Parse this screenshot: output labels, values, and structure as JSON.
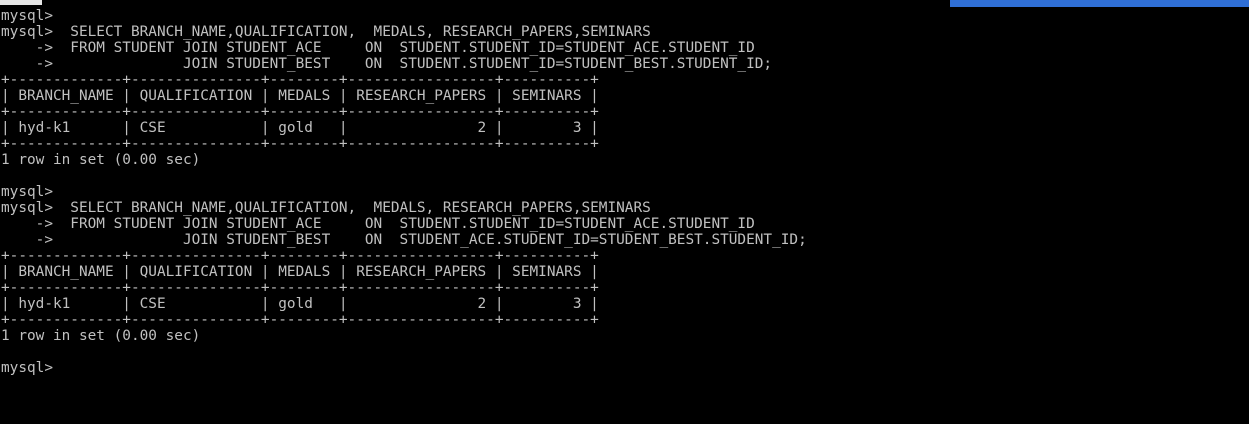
{
  "colors": {
    "background": "#000000",
    "text": "#c0c0c0",
    "titlebar_accent": "#2f6fd6"
  },
  "console": {
    "lines": [
      "mysql>",
      "mysql>  SELECT BRANCH_NAME,QUALIFICATION,  MEDALS, RESEARCH_PAPERS,SEMINARS",
      "    ->  FROM STUDENT JOIN STUDENT_ACE     ON  STUDENT.STUDENT_ID=STUDENT_ACE.STUDENT_ID",
      "    ->               JOIN STUDENT_BEST    ON  STUDENT.STUDENT_ID=STUDENT_BEST.STUDENT_ID;",
      "+-------------+---------------+--------+-----------------+----------+",
      "| BRANCH_NAME | QUALIFICATION | MEDALS | RESEARCH_PAPERS | SEMINARS |",
      "+-------------+---------------+--------+-----------------+----------+",
      "| hyd-k1      | CSE           | gold   |               2 |        3 |",
      "+-------------+---------------+--------+-----------------+----------+",
      "1 row in set (0.00 sec)",
      "",
      "mysql>",
      "mysql>  SELECT BRANCH_NAME,QUALIFICATION,  MEDALS, RESEARCH_PAPERS,SEMINARS",
      "    ->  FROM STUDENT JOIN STUDENT_ACE     ON  STUDENT.STUDENT_ID=STUDENT_ACE.STUDENT_ID",
      "    ->               JOIN STUDENT_BEST    ON  STUDENT_ACE.STUDENT_ID=STUDENT_BEST.STUDENT_ID;",
      "+-------------+---------------+--------+-----------------+----------+",
      "| BRANCH_NAME | QUALIFICATION | MEDALS | RESEARCH_PAPERS | SEMINARS |",
      "+-------------+---------------+--------+-----------------+----------+",
      "| hyd-k1      | CSE           | gold   |               2 |        3 |",
      "+-------------+---------------+--------+-----------------+----------+",
      "1 row in set (0.00 sec)",
      "",
      "mysql>"
    ]
  }
}
